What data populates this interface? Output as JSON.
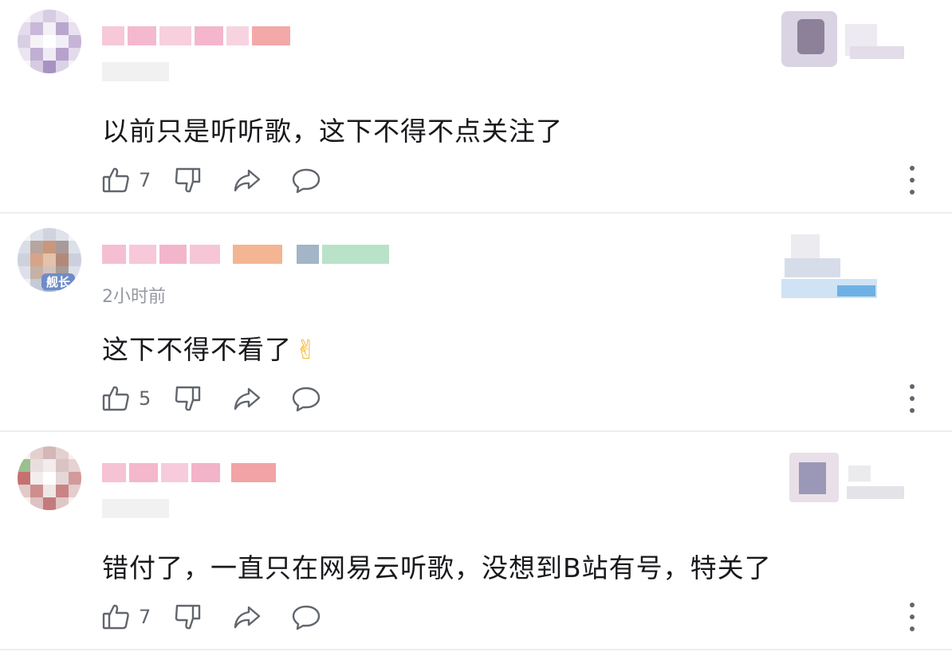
{
  "comments": [
    {
      "time": "",
      "content": "以前只是听听歌，这下不得不点关注了",
      "likes": "7"
    },
    {
      "time": "2小时前",
      "content": "这下不得不看了",
      "emoji": "✌",
      "avatar_badge": "舰长",
      "likes": "5"
    },
    {
      "time": "",
      "content": "错付了，一直只在网易云听歌，没想到B站有号，特关了",
      "likes": "7"
    }
  ],
  "icons": {
    "like": "thumb-up-icon",
    "dislike": "thumb-down-icon",
    "share": "share-icon",
    "reply": "reply-icon",
    "more": "more-icon"
  },
  "colors": {
    "text": "#18191c",
    "secondary": "#61666d",
    "time": "#9499a0",
    "divider": "#ececec"
  }
}
